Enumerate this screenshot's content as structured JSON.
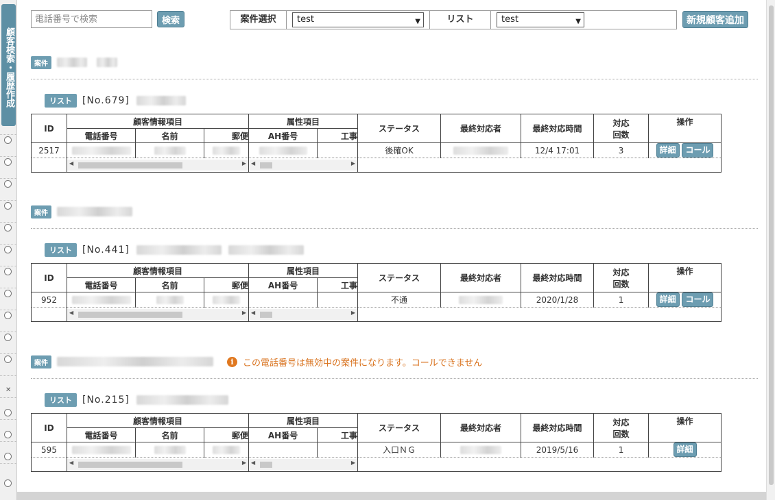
{
  "sidebar": {
    "tab_label": "顧客検索・履歴作成"
  },
  "toolbar": {
    "search_placeholder": "電話番号で検索",
    "search_button": "検索",
    "project_select_label": "案件選択",
    "project_select_value": "test",
    "list_label": "リスト",
    "list_select_value": "test",
    "add_customer_button": "新規顧客追加"
  },
  "badges": {
    "anken": "案件",
    "list": "リスト"
  },
  "table_headers": {
    "id": "ID",
    "customer_info": "顧客情報項目",
    "attributes": "属性項目",
    "status": "ステータス",
    "last_handler": "最終対応者",
    "last_time": "最終対応時間",
    "count_line1": "対応",
    "count_line2": "回数",
    "actions": "操作",
    "phone": "電話番号",
    "name": "名前",
    "postal": "郵便",
    "ah_no": "AH番号",
    "construction": "工事"
  },
  "buttons": {
    "detail": "詳細",
    "call": "コール"
  },
  "sections": [
    {
      "list_no": "[No.679]",
      "row": {
        "id": "2517",
        "status": "後確OK",
        "last_time": "12/4 17:01",
        "count": "3"
      }
    },
    {
      "list_no": "[No.441]",
      "row": {
        "id": "952",
        "status": "不通",
        "last_time": "2020/1/28",
        "count": "1"
      }
    },
    {
      "list_no": "[No.215]",
      "warning": "この電話番号は無効中の案件になります。コールできません",
      "row": {
        "id": "595",
        "status": "入口ＮＧ",
        "last_time": "2019/5/16",
        "count": "1"
      }
    }
  ],
  "colors": {
    "accent": "#6d9db1",
    "warning": "#e0781f"
  }
}
